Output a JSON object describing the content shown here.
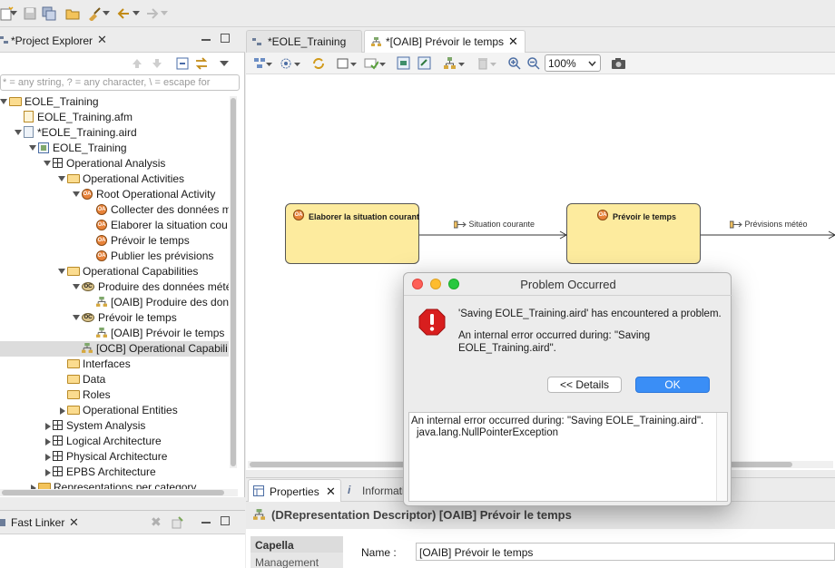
{
  "explorer": {
    "title": "*Project Explorer",
    "filter_placeholder": "* = any string, ? = any character, \\ = escape for",
    "tree": [
      {
        "label": "EOLE_Training",
        "depth": 0,
        "icon": "project-icon",
        "twisty": "open"
      },
      {
        "label": "EOLE_Training.afm",
        "depth": 1,
        "icon": "afm-file-icon",
        "twisty": "none"
      },
      {
        "label": "*EOLE_Training.aird",
        "depth": 1,
        "icon": "aird-file-icon",
        "twisty": "open"
      },
      {
        "label": "EOLE_Training",
        "depth": 2,
        "icon": "model-icon",
        "twisty": "open"
      },
      {
        "label": "Operational Analysis",
        "depth": 3,
        "icon": "grid-icon",
        "twisty": "open"
      },
      {
        "label": "Operational Activities",
        "depth": 4,
        "icon": "folder-open-icon",
        "twisty": "open"
      },
      {
        "label": "Root Operational Activity",
        "depth": 5,
        "icon": "operational-activity-icon",
        "twisty": "open"
      },
      {
        "label": "Collecter des données m",
        "depth": 6,
        "icon": "operational-activity-icon",
        "twisty": "none"
      },
      {
        "label": "Elaborer la situation cou",
        "depth": 6,
        "icon": "operational-activity-icon",
        "twisty": "none"
      },
      {
        "label": "Prévoir le temps",
        "depth": 6,
        "icon": "operational-activity-icon",
        "twisty": "none"
      },
      {
        "label": "Publier les prévisions",
        "depth": 6,
        "icon": "operational-activity-icon",
        "twisty": "none"
      },
      {
        "label": "Operational Capabilities",
        "depth": 4,
        "icon": "folder-open-icon",
        "twisty": "open"
      },
      {
        "label": "Produire des données mété",
        "depth": 5,
        "icon": "operational-capability-icon",
        "twisty": "open"
      },
      {
        "label": "[OAIB] Produire des don",
        "depth": 6,
        "icon": "diagram-icon",
        "twisty": "none"
      },
      {
        "label": "Prévoir le temps",
        "depth": 5,
        "icon": "operational-capability-icon",
        "twisty": "open"
      },
      {
        "label": "[OAIB] Prévoir le temps",
        "depth": 6,
        "icon": "diagram-icon",
        "twisty": "none"
      },
      {
        "label": "[OCB] Operational Capabili",
        "depth": 5,
        "icon": "diagram-icon",
        "twisty": "none",
        "selected": true
      },
      {
        "label": "Interfaces",
        "depth": 4,
        "icon": "folder-open-icon",
        "twisty": "none"
      },
      {
        "label": "Data",
        "depth": 4,
        "icon": "folder-open-icon",
        "twisty": "none"
      },
      {
        "label": "Roles",
        "depth": 4,
        "icon": "folder-open-icon",
        "twisty": "none"
      },
      {
        "label": "Operational Entities",
        "depth": 4,
        "icon": "folder-open-icon",
        "twisty": "closed"
      },
      {
        "label": "System Analysis",
        "depth": 3,
        "icon": "grid-icon",
        "twisty": "closed"
      },
      {
        "label": "Logical Architecture",
        "depth": 3,
        "icon": "grid-icon",
        "twisty": "closed"
      },
      {
        "label": "Physical Architecture",
        "depth": 3,
        "icon": "grid-icon",
        "twisty": "closed"
      },
      {
        "label": "EPBS Architecture",
        "depth": 3,
        "icon": "grid-icon",
        "twisty": "closed"
      },
      {
        "label": "Representations per category",
        "depth": 2,
        "icon": "folder-closed-icon",
        "twisty": "closed"
      }
    ]
  },
  "fast_linker": {
    "title": "Fast Linker"
  },
  "editor": {
    "tabs": [
      {
        "label": "*EOLE_Training",
        "active": false
      },
      {
        "label": "*[OAIB] Prévoir le temps",
        "active": true
      }
    ],
    "zoom": "100%",
    "nodes": [
      {
        "label": "Elaborer la situation courant",
        "badge": "OA"
      },
      {
        "label": "Prévoir le temps",
        "badge": "OA"
      }
    ],
    "flows": [
      "Situation courante",
      "Prévisions météo"
    ]
  },
  "properties": {
    "tabs": [
      "Properties",
      "Information"
    ],
    "title": "(DRepresentation Descriptor)  [OAIB] Prévoir le temps",
    "categories": [
      "Capella",
      "Management"
    ],
    "name_label": "Name :",
    "name_value": "[OAIB] Prévoir le temps"
  },
  "dialog": {
    "title": "Problem Occurred",
    "message": "'Saving EOLE_Training.aird' has encountered a problem.",
    "detail_line1": "An internal error occurred during: \"Saving",
    "detail_line2": "EOLE_Training.aird\".",
    "details_button": "<< Details",
    "ok_button": "OK",
    "stack_line1": "An internal error occurred during: \"Saving EOLE_Training.aird\".",
    "stack_line2": "java.lang.NullPointerException",
    "colors": {
      "close": "#fe5f57",
      "minimize": "#febc2e",
      "zoom": "#28c840",
      "ok": "#3a8ef6",
      "error": "#d81e1e"
    }
  }
}
